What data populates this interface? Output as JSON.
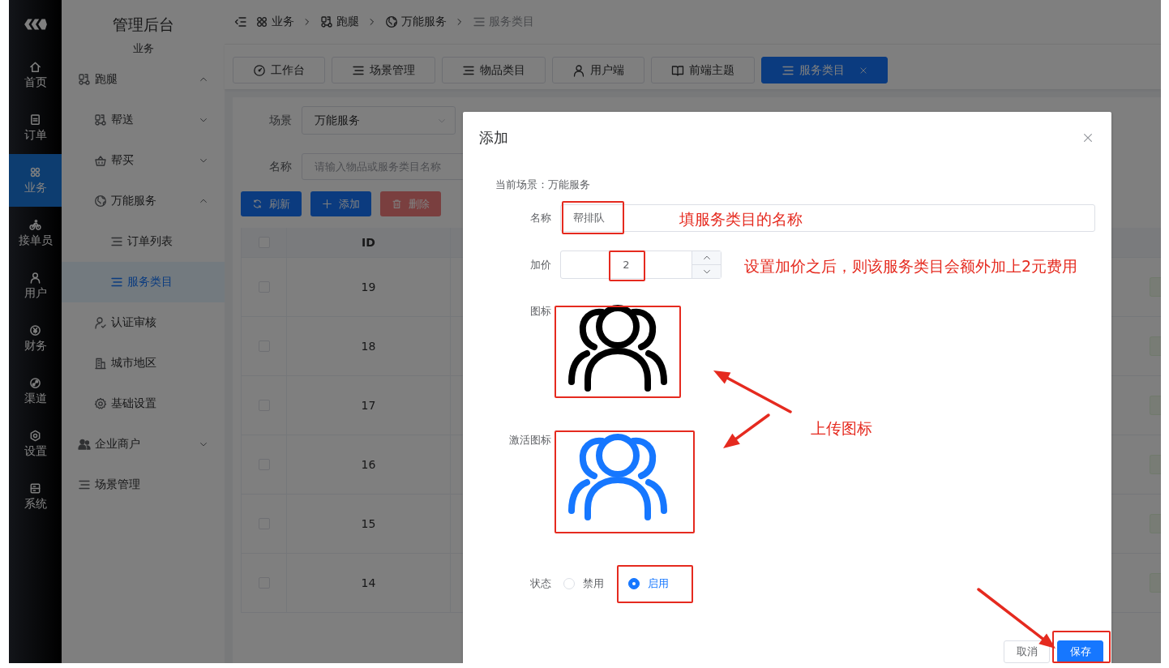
{
  "rail": {
    "items": [
      {
        "label": "首页",
        "selected": false
      },
      {
        "label": "订单",
        "selected": false
      },
      {
        "label": "业务",
        "selected": true
      },
      {
        "label": "接单员",
        "selected": false
      },
      {
        "label": "用户",
        "selected": false
      },
      {
        "label": "财务",
        "selected": false
      },
      {
        "label": "渠道",
        "selected": false
      },
      {
        "label": "设置",
        "selected": false
      },
      {
        "label": "系统",
        "selected": false
      }
    ]
  },
  "sidebar": {
    "title": "管理后台",
    "subtitle": "业务",
    "items": [
      {
        "label": "跑腿",
        "expanded": true,
        "selected": false,
        "children": [
          {
            "label": "帮送",
            "expanded": false,
            "selected": false
          },
          {
            "label": "帮买",
            "expanded": false,
            "selected": false
          },
          {
            "label": "万能服务",
            "expanded": true,
            "selected": false,
            "children": [
              {
                "label": "订单列表",
                "selected": false
              },
              {
                "label": "服务类目",
                "selected": true
              }
            ]
          },
          {
            "label": "认证审核",
            "selected": false
          },
          {
            "label": "城市地区",
            "selected": false
          },
          {
            "label": "基础设置",
            "selected": false
          }
        ]
      },
      {
        "label": "企业商户",
        "expanded": false,
        "selected": false
      },
      {
        "label": "场景管理",
        "selected": false
      }
    ]
  },
  "breadcrumb": [
    "业务",
    "跑腿",
    "万能服务",
    "服务类目"
  ],
  "tabs": [
    {
      "label": "工作台",
      "selected": false,
      "closable": false
    },
    {
      "label": "场景管理",
      "selected": false,
      "closable": false
    },
    {
      "label": "物品类目",
      "selected": false,
      "closable": false
    },
    {
      "label": "用户端",
      "selected": false,
      "closable": false
    },
    {
      "label": "前端主题",
      "selected": false,
      "closable": false
    },
    {
      "label": "服务类目",
      "selected": true,
      "closable": true
    }
  ],
  "filters": {
    "scene": {
      "label": "场景",
      "value": "万能服务"
    },
    "name": {
      "label": "名称",
      "placeholder": "请输入物品或服务类目名称"
    }
  },
  "toolbar": [
    {
      "label": "刷新",
      "disabled": false
    },
    {
      "label": "添加",
      "disabled": false
    },
    {
      "label": "删除",
      "disabled": true
    }
  ],
  "table": {
    "columns": [
      "ID"
    ],
    "header_checked": false,
    "rows": [
      {
        "id": "19",
        "checked": false
      },
      {
        "id": "18",
        "checked": false
      },
      {
        "id": "17",
        "checked": false
      },
      {
        "id": "16",
        "checked": false
      },
      {
        "id": "15",
        "checked": false
      },
      {
        "id": "14",
        "checked": false
      }
    ]
  },
  "dialog": {
    "title": "添加",
    "scene_line": "当前场景：万能服务",
    "fields": [
      {
        "kind": "text",
        "label": "名称",
        "value": "帮排队"
      },
      {
        "kind": "number",
        "label": "加价",
        "value": "2"
      },
      {
        "kind": "image",
        "label": "图标",
        "color": "#000000"
      },
      {
        "kind": "image",
        "label": "激活图标",
        "color": "#1677ff"
      },
      {
        "kind": "radio",
        "label": "状态",
        "options": [
          {
            "label": "禁用",
            "selected": false
          },
          {
            "label": "启用",
            "selected": true
          }
        ]
      }
    ],
    "buttons": [
      {
        "label": "取消",
        "primary": false
      },
      {
        "label": "保存",
        "primary": true
      }
    ]
  },
  "annotations": [
    {
      "text": "填服务类目的名称"
    },
    {
      "text": "设置加价之后，则该服务类目会额外加上2元费用"
    },
    {
      "text": "上传图标"
    }
  ]
}
